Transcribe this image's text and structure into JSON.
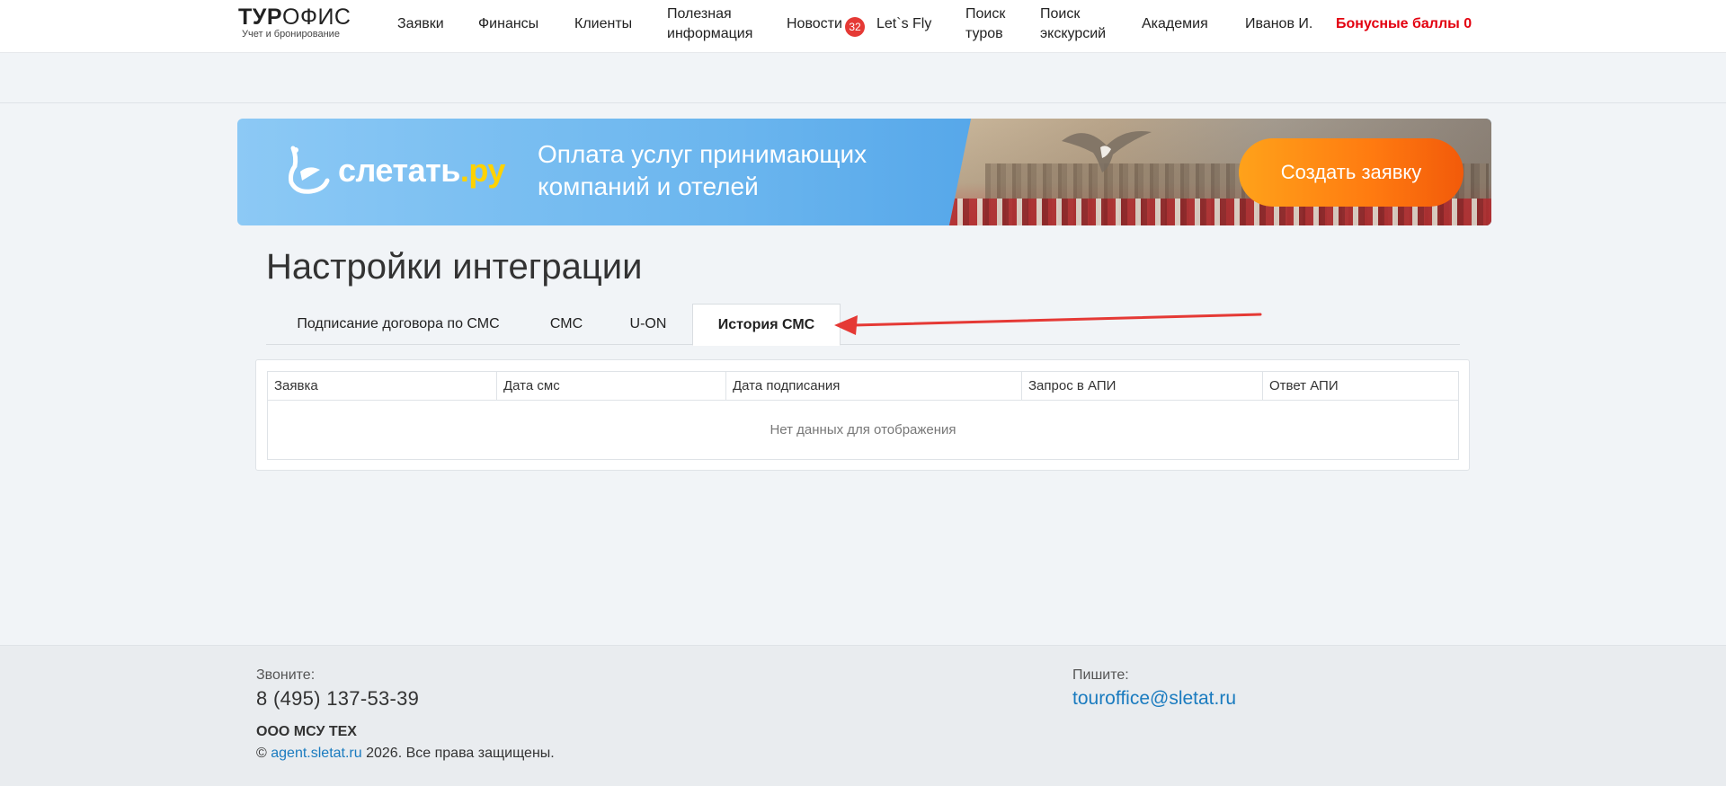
{
  "header": {
    "logo_bold": "ТУР",
    "logo_light": "ОФИС",
    "logo_sub": "Учет и бронирование",
    "nav": [
      {
        "label": "Заявки"
      },
      {
        "label": "Финансы"
      },
      {
        "label": "Клиенты"
      },
      {
        "label": "Полезная информация"
      },
      {
        "label": "Новости"
      },
      {
        "label": "Let`s Fly"
      },
      {
        "label": "Поиск туров"
      },
      {
        "label": "Поиск экскурсий"
      },
      {
        "label": "Академия"
      },
      {
        "label": "Иванов И."
      }
    ],
    "news_badge": "32",
    "bonus_label": "Бонусные баллы 0",
    "bonus_color": "#e3000f"
  },
  "banner": {
    "brand_main": "слетать",
    "brand_suffix": ".ру",
    "text": "Оплата услуг принимающих компаний и отелей",
    "button_label": "Создать заявку",
    "button_color": "#ff7a10"
  },
  "page": {
    "title": "Настройки интеграции",
    "tabs": [
      {
        "label": "Подписание договора по СМС",
        "active": false
      },
      {
        "label": "СМС",
        "active": false
      },
      {
        "label": "U-ON",
        "active": false
      },
      {
        "label": "История СМС",
        "active": true
      }
    ],
    "grid": {
      "columns": [
        "Заявка",
        "Дата смс",
        "Дата подписания",
        "Запрос в АПИ",
        "Ответ АПИ"
      ],
      "empty_text": "Нет данных для отображения"
    },
    "annotation_color": "#e53935"
  },
  "footer": {
    "call_label": "Звоните:",
    "phone": "8 (495) 137-53-39",
    "write_label": "Пишите:",
    "email": "touroffice@sletat.ru",
    "company": "ООО МСУ ТЕХ",
    "copy_prefix": "©",
    "copy_link": "agent.sletat.ru",
    "copy_suffix": "2026. Все права защищены.",
    "link_color": "#1a7bbf"
  }
}
